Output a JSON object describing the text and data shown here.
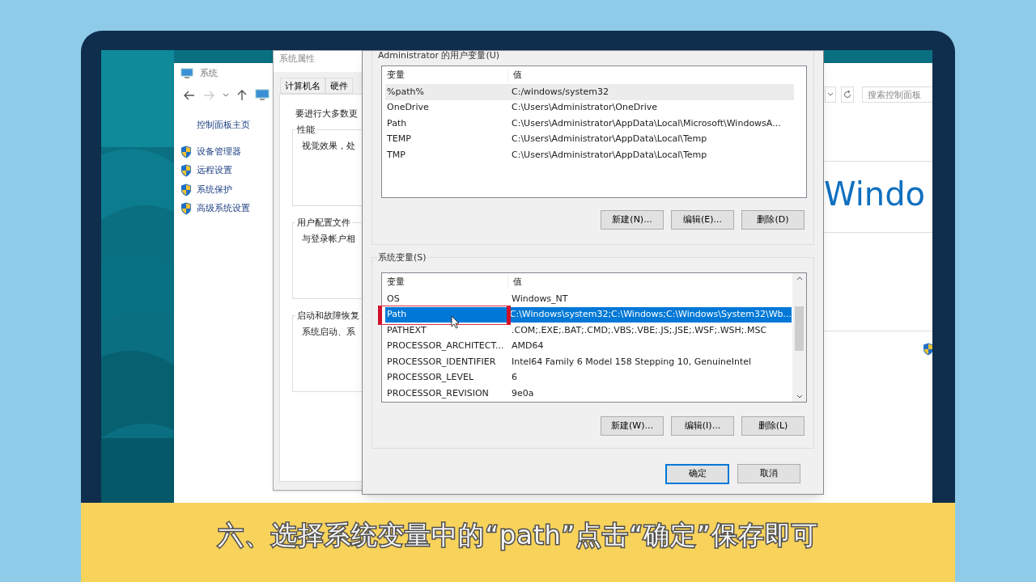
{
  "caption": "六、选择系统变量中的“path”点击“确定”保存即可",
  "system_window": {
    "title": "系统",
    "search": {
      "placeholder": "搜索控制面板"
    },
    "sidebar": {
      "home": "控制面板主页",
      "items": [
        "设备管理器",
        "远程设置",
        "系统保护",
        "高级系统设置"
      ]
    },
    "heading": "Windo"
  },
  "properties_dialog": {
    "title": "系统属性",
    "tabs": [
      {
        "label": "计算机名",
        "selected": false
      },
      {
        "label": "硬件",
        "selected": false
      }
    ],
    "intro": "要进行大多数更",
    "groups": [
      {
        "title": "性能",
        "text": "视觉效果，处"
      },
      {
        "title": "用户配置文件",
        "text": "与登录帐户相"
      },
      {
        "title": "启动和故障恢复",
        "text": "系统启动、系"
      }
    ]
  },
  "env_dialog": {
    "user_vars": {
      "label": "Administrator 的用户变量(U)",
      "columns": [
        "变量",
        "值"
      ],
      "rows": [
        {
          "name": "%path%",
          "value": "C:/windows/system32",
          "selected": false,
          "hovered": true
        },
        {
          "name": "OneDrive",
          "value": "C:\\Users\\Administrator\\OneDrive",
          "selected": false,
          "hovered": false
        },
        {
          "name": "Path",
          "value": "C:\\Users\\Administrator\\AppData\\Local\\Microsoft\\WindowsA...",
          "selected": false,
          "hovered": false
        },
        {
          "name": "TEMP",
          "value": "C:\\Users\\Administrator\\AppData\\Local\\Temp",
          "selected": false,
          "hovered": false
        },
        {
          "name": "TMP",
          "value": "C:\\Users\\Administrator\\AppData\\Local\\Temp",
          "selected": false,
          "hovered": false
        }
      ],
      "buttons": [
        "新建(N)...",
        "编辑(E)...",
        "删除(D)"
      ]
    },
    "system_vars": {
      "label": "系统变量(S)",
      "columns": [
        "变量",
        "值"
      ],
      "rows": [
        {
          "name": "OS",
          "value": "Windows_NT",
          "selected": false
        },
        {
          "name": "Path",
          "value": "C:\\Windows\\system32;C:\\Windows;C:\\Windows\\System32\\Wb...",
          "selected": true
        },
        {
          "name": "PATHEXT",
          "value": ".COM;.EXE;.BAT;.CMD;.VBS;.VBE;.JS;.JSE;.WSF;.WSH;.MSC",
          "selected": false
        },
        {
          "name": "PROCESSOR_ARCHITECT...",
          "value": "AMD64",
          "selected": false
        },
        {
          "name": "PROCESSOR_IDENTIFIER",
          "value": "Intel64 Family 6 Model 158 Stepping 10, GenuineIntel",
          "selected": false
        },
        {
          "name": "PROCESSOR_LEVEL",
          "value": "6",
          "selected": false
        },
        {
          "name": "PROCESSOR_REVISION",
          "value": "9e0a",
          "selected": false
        }
      ],
      "buttons": [
        "新建(W)...",
        "编辑(I)...",
        "删除(L)"
      ]
    },
    "footer_buttons": [
      {
        "label": "确定",
        "default": true
      },
      {
        "label": "取消",
        "default": false
      }
    ]
  }
}
